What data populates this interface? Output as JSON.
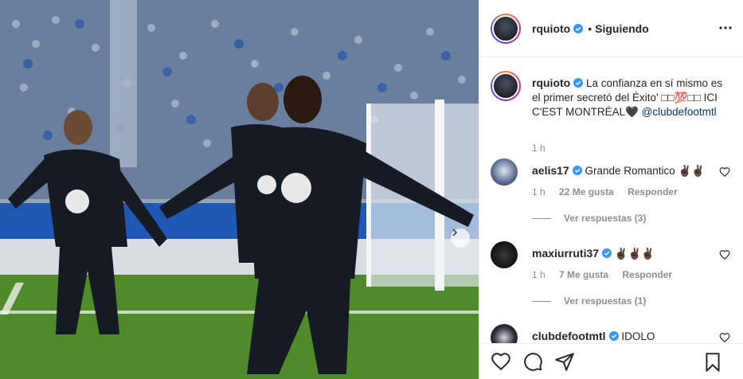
{
  "post": {
    "image_alt": "",
    "next_icon": "chevron-right-icon"
  },
  "header": {
    "username": "rquioto",
    "dot": "•",
    "follow_status": "Siguiendo",
    "more_icon": "more-horizontal-icon"
  },
  "caption": {
    "username": "rquioto",
    "text": "La confianza en sí mismo es el primer secretó del Éxito' □□💯□□ ICI C'EST MONTRÉAL🖤 ",
    "mention": "@clubdefootmtl",
    "time": "1 h"
  },
  "comments": [
    {
      "username": "aelis17",
      "text": "Grande Romantico ✌🏿✌🏿",
      "time": "1 h",
      "likes": "22 Me gusta",
      "reply": "Responder",
      "view_replies": "Ver respuestas (3)"
    },
    {
      "username": "maxiurruti37",
      "text": "✌🏿✌🏿✌🏿",
      "time": "1 h",
      "likes": "7 Me gusta",
      "reply": "Responder",
      "view_replies": "Ver respuestas (1)"
    },
    {
      "username": "clubdefootmtl",
      "text": "IDOLO"
    }
  ],
  "actions": {
    "like_icon": "heart-icon",
    "comment_icon": "comment-icon",
    "share_icon": "share-icon",
    "save_icon": "bookmark-icon"
  },
  "colors": {
    "verified": "#3897f0",
    "mention": "#00376b",
    "muted": "#8e8e8e"
  }
}
